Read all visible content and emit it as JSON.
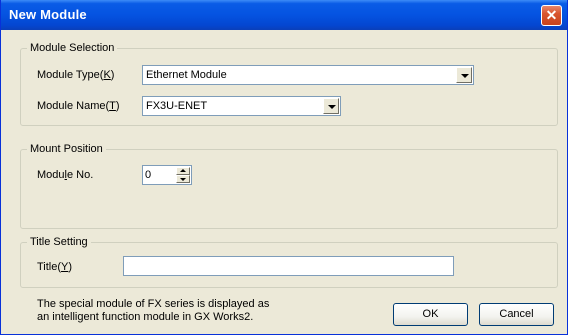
{
  "window": {
    "title": "New Module",
    "close_glyph": "✕"
  },
  "module_selection": {
    "legend": "Module Selection",
    "type_label_pre": "Module Type(",
    "type_label_key": "K",
    "type_label_post": ")",
    "type_value": "Ethernet Module",
    "name_label_pre": "Module Name(",
    "name_label_key": "T",
    "name_label_post": ")",
    "name_value": "FX3U-ENET"
  },
  "mount_position": {
    "legend": "Mount Position",
    "module_no_label_pre": "Modu",
    "module_no_label_key": "l",
    "module_no_label_post": "e No.",
    "module_no_value": "0"
  },
  "title_setting": {
    "legend": "Title Setting",
    "title_label_pre": "Title(",
    "title_label_key": "Y",
    "title_label_post": ")",
    "title_value": ""
  },
  "footer": {
    "note_line1": "The special module of FX series is displayed as",
    "note_line2": "an intelligent function module in GX Works2.",
    "ok_label": "OK",
    "cancel_label": "Cancel"
  },
  "icons": {
    "close": "close-icon",
    "dropdown": "chevron-down-icon",
    "spin_up": "spin-up-icon",
    "spin_down": "spin-down-icon"
  }
}
